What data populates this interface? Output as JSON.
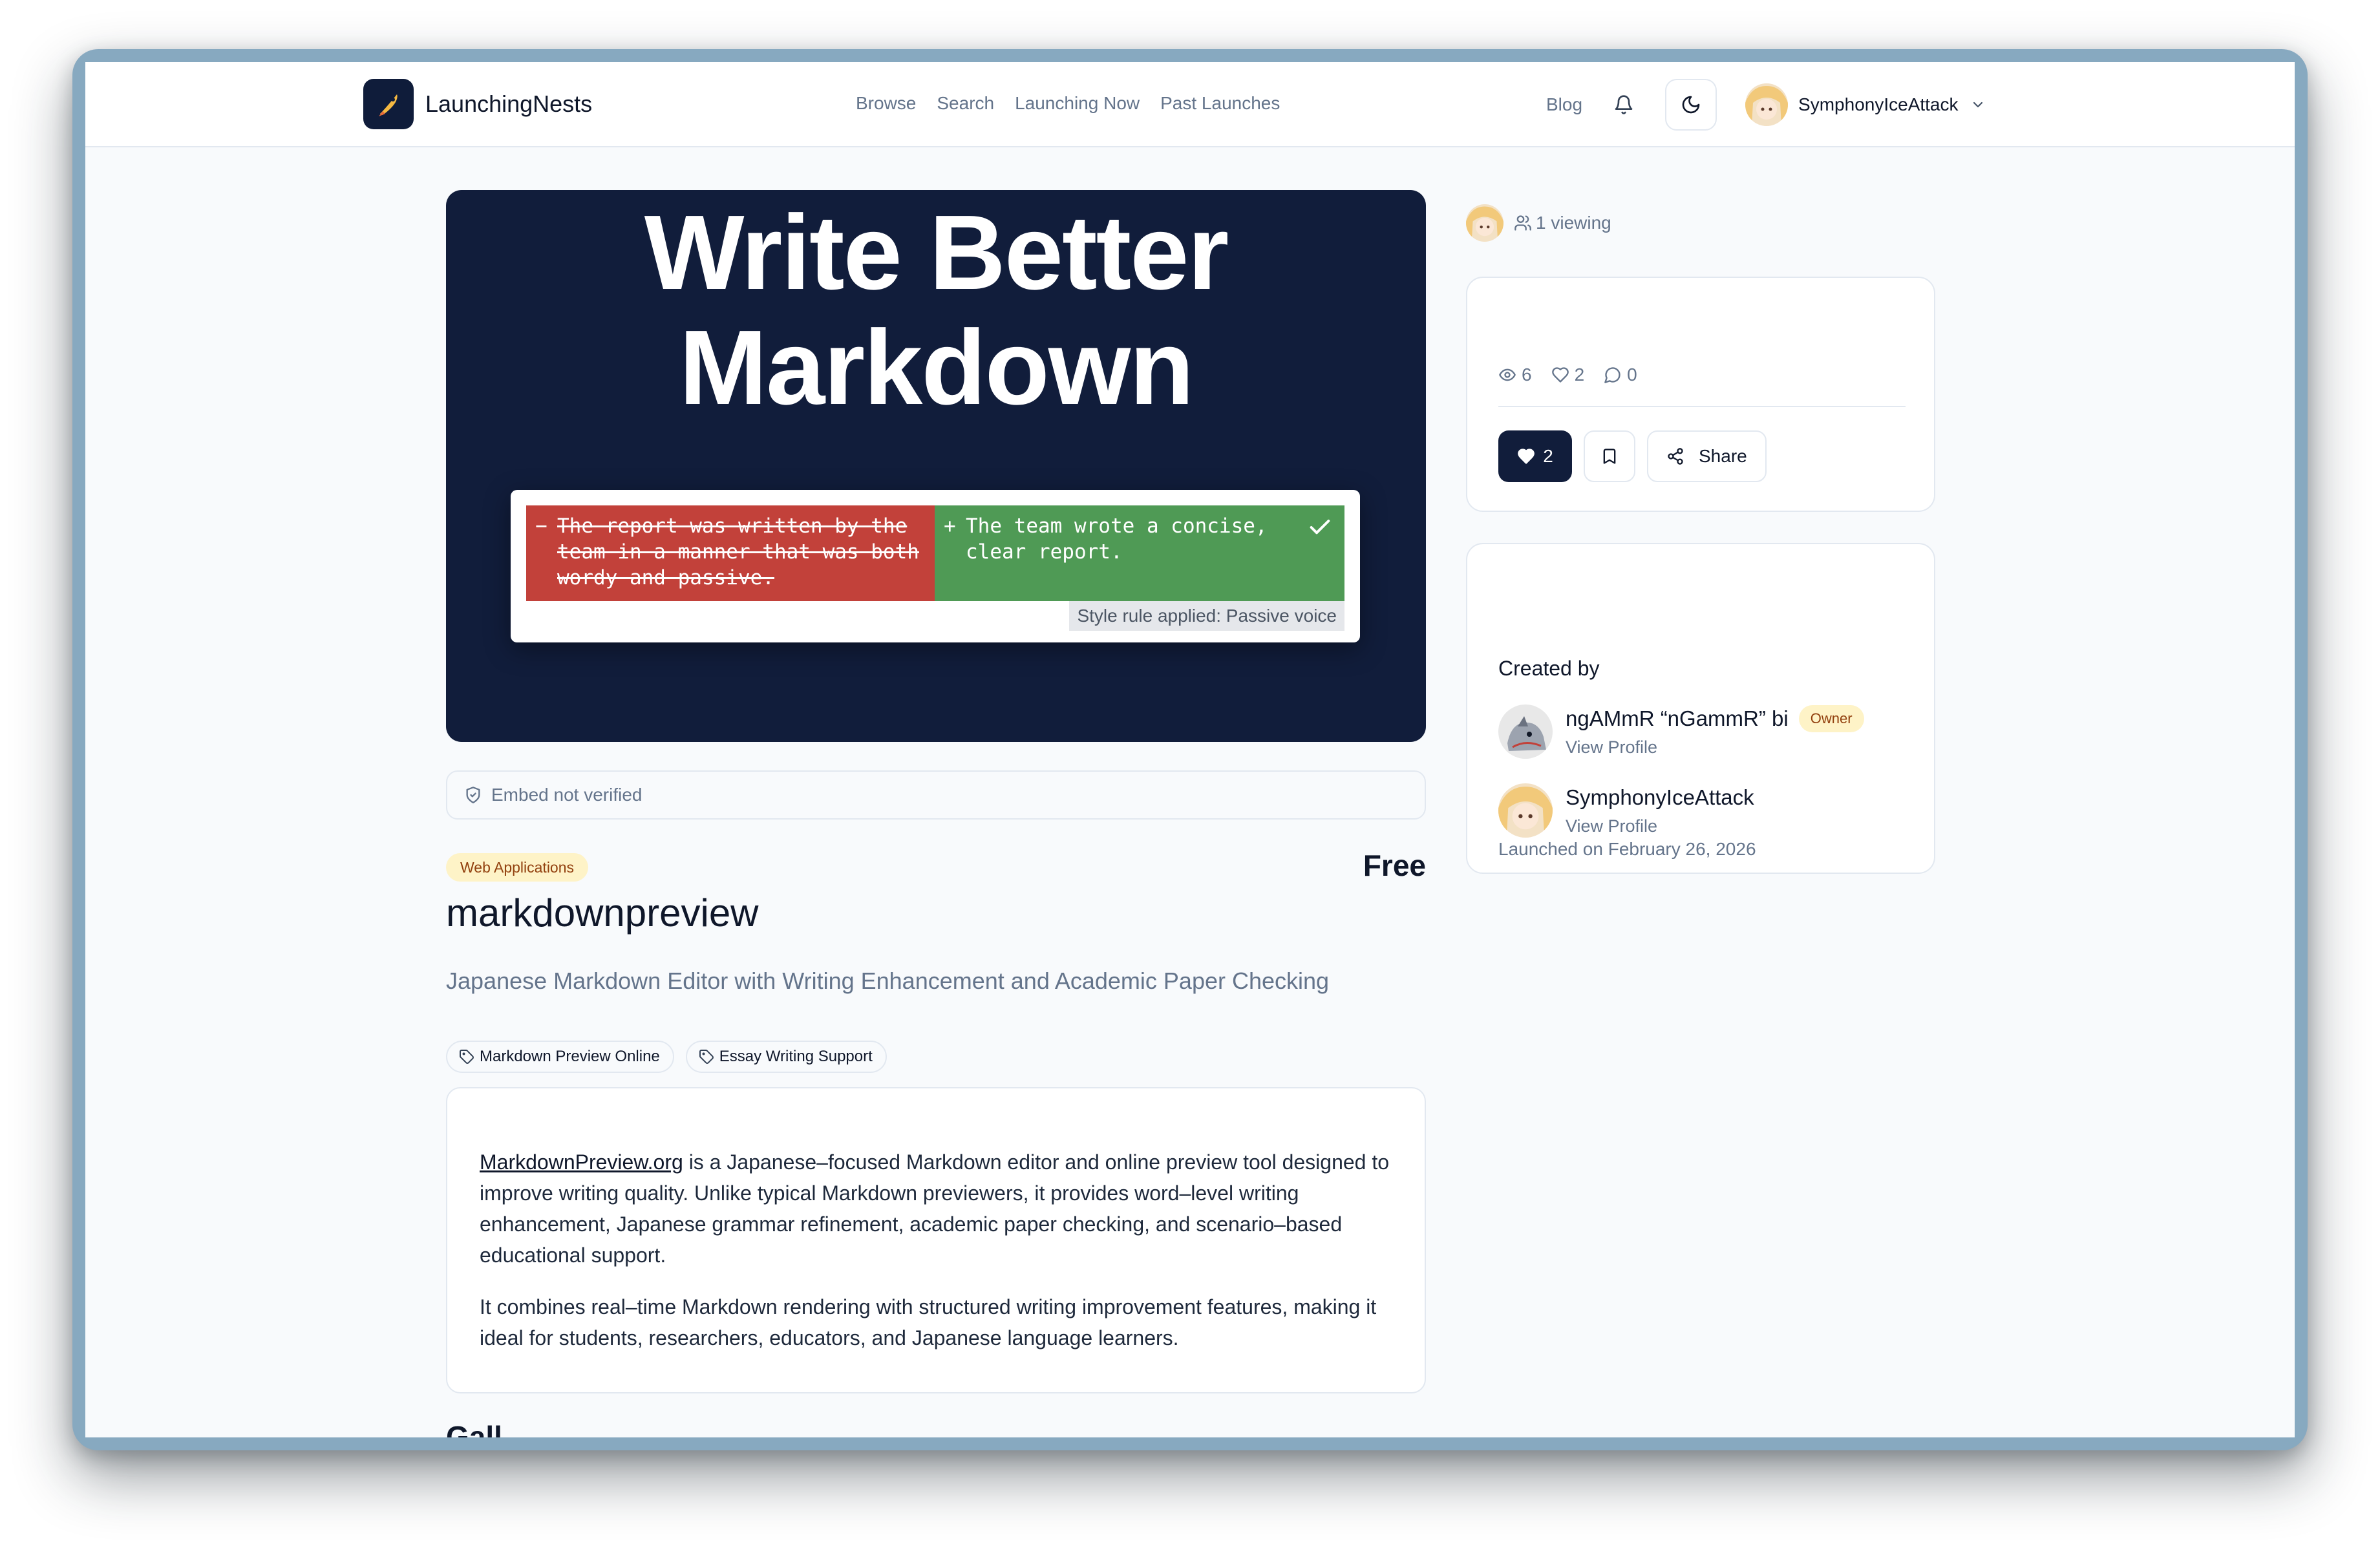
{
  "header": {
    "brand": "LaunchingNests",
    "nav": [
      "Browse",
      "Search",
      "Launching Now",
      "Past Launches"
    ],
    "blog": "Blog",
    "user_name": "SymphonyIceAttack"
  },
  "hero": {
    "title_line1": "Write Better",
    "title_line2": "Markdown",
    "diff_old_mark": "−",
    "diff_old_text": "The report was written by the team in a manner that was both wordy and passive.",
    "diff_new_mark": "+",
    "diff_new_text": "The team wrote a concise, clear report.",
    "rule_label": "Style rule applied: Passive voice"
  },
  "embed": {
    "status": "Embed not verified"
  },
  "product": {
    "category": "Web Applications",
    "price": "Free",
    "name": "markdownpreview",
    "subtitle": "Japanese Markdown Editor with Writing Enhancement and Academic Paper Checking",
    "tags": [
      "Markdown Preview Online",
      "Essay Writing Support"
    ],
    "description_link": "MarkdownPreview.org",
    "description_p1_rest": " is a Japanese–focused Markdown editor and online preview tool designed to improve writing quality. Unlike typical Markdown previewers, it provides word–level writing enhancement, Japanese grammar refinement, academic paper checking, and scenario–based educational support.",
    "description_p2": "It combines real–time Markdown rendering with structured writing improvement features, making it ideal for students, researchers, educators, and Japanese language learners.",
    "gallery_peek": "Gall"
  },
  "sidebar": {
    "viewing": "1 viewing",
    "stats": {
      "views": "6",
      "likes": "2",
      "comments": "0"
    },
    "like_button": "2",
    "share_button": "Share",
    "created_by": "Created by",
    "creators": [
      {
        "name": "ngAMmR “nGammR” bi",
        "badge": "Owner",
        "link": "View Profile"
      },
      {
        "name": "SymphonyIceAttack",
        "link": "View Profile"
      }
    ],
    "launched": "Launched on February 26, 2026"
  },
  "colors": {
    "primary": "#111d3b",
    "diff_removed": "#c2413a",
    "diff_added": "#4f9a55",
    "badge_bg": "#fef3c7",
    "badge_text": "#92400e"
  }
}
